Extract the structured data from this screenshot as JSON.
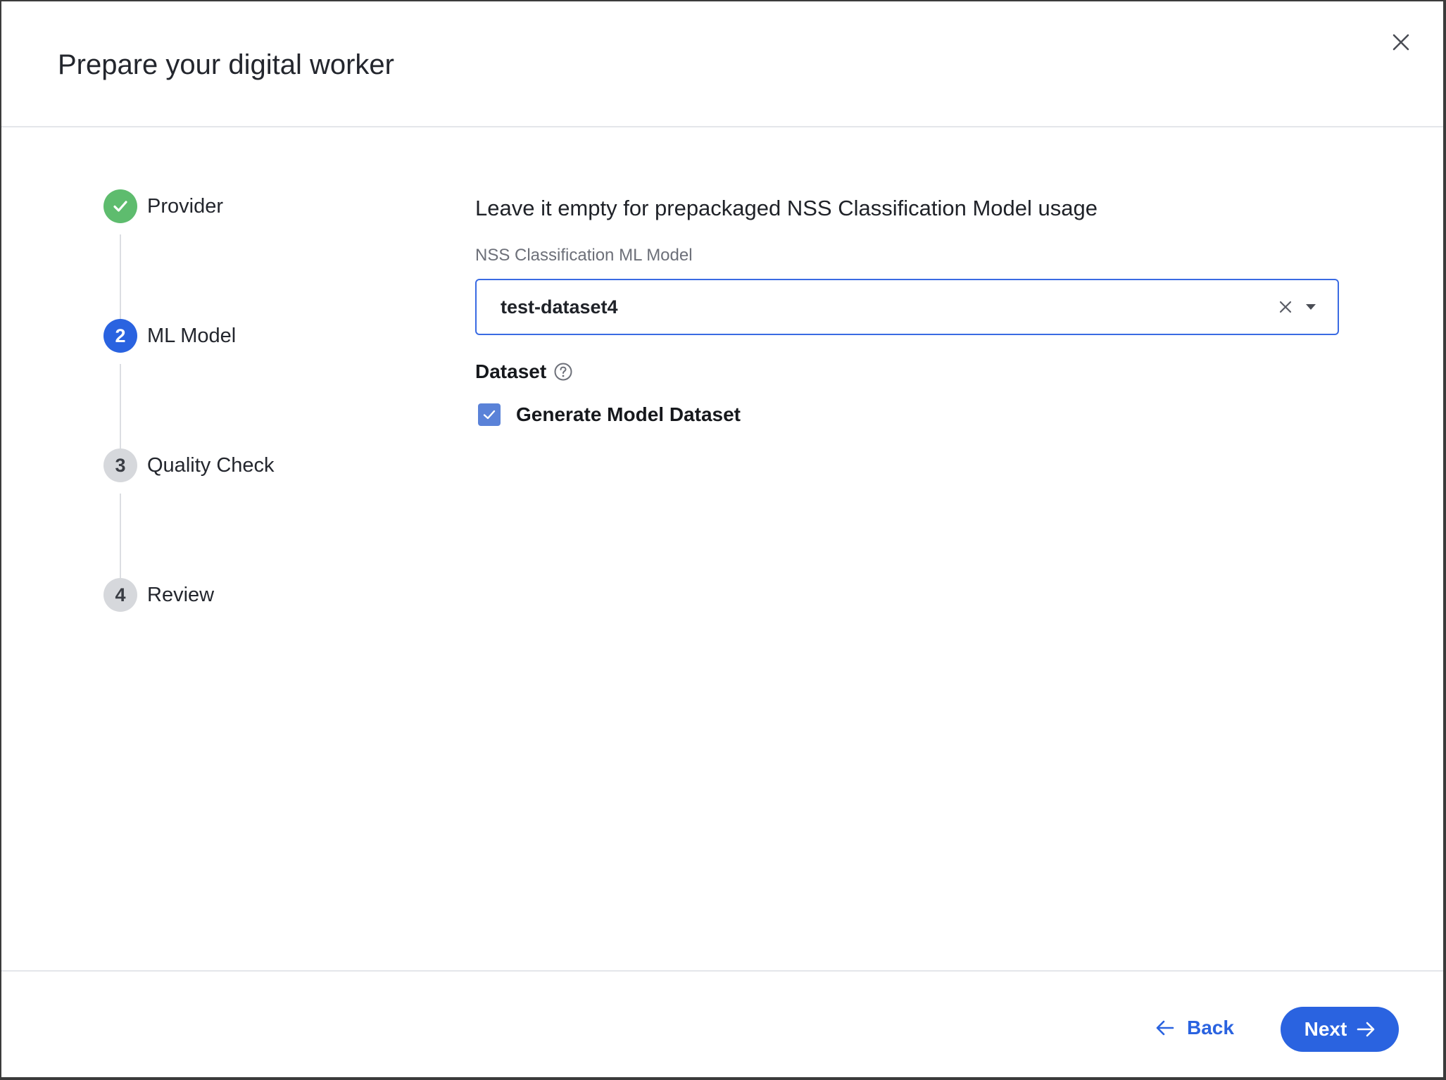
{
  "modal": {
    "title": "Prepare your digital worker"
  },
  "stepper": {
    "steps": [
      {
        "number": "",
        "label": "Provider",
        "state": "completed"
      },
      {
        "number": "2",
        "label": "ML Model",
        "state": "active"
      },
      {
        "number": "3",
        "label": "Quality Check",
        "state": "pending"
      },
      {
        "number": "4",
        "label": "Review",
        "state": "pending"
      }
    ]
  },
  "content": {
    "heading": "Leave it empty for prepackaged NSS Classification Model usage",
    "model_field": {
      "label": "NSS Classification ML Model",
      "value": "test-dataset4"
    },
    "dataset": {
      "label": "Dataset",
      "checkbox_label": "Generate Model Dataset",
      "checked": true
    }
  },
  "footer": {
    "back_label": "Back",
    "next_label": "Next"
  },
  "colors": {
    "primary": "#2a63e0",
    "success": "#5ebc6e",
    "pending": "#d6d8dc",
    "checkbox": "#5a82d8"
  },
  "icons": {
    "close": "close-icon",
    "completed_step": "check-icon",
    "clear": "clear-icon",
    "dropdown": "chevron-down-icon",
    "help": "help-circle-icon",
    "checkbox": "check-icon",
    "back": "arrow-left-icon",
    "next": "arrow-right-icon"
  }
}
